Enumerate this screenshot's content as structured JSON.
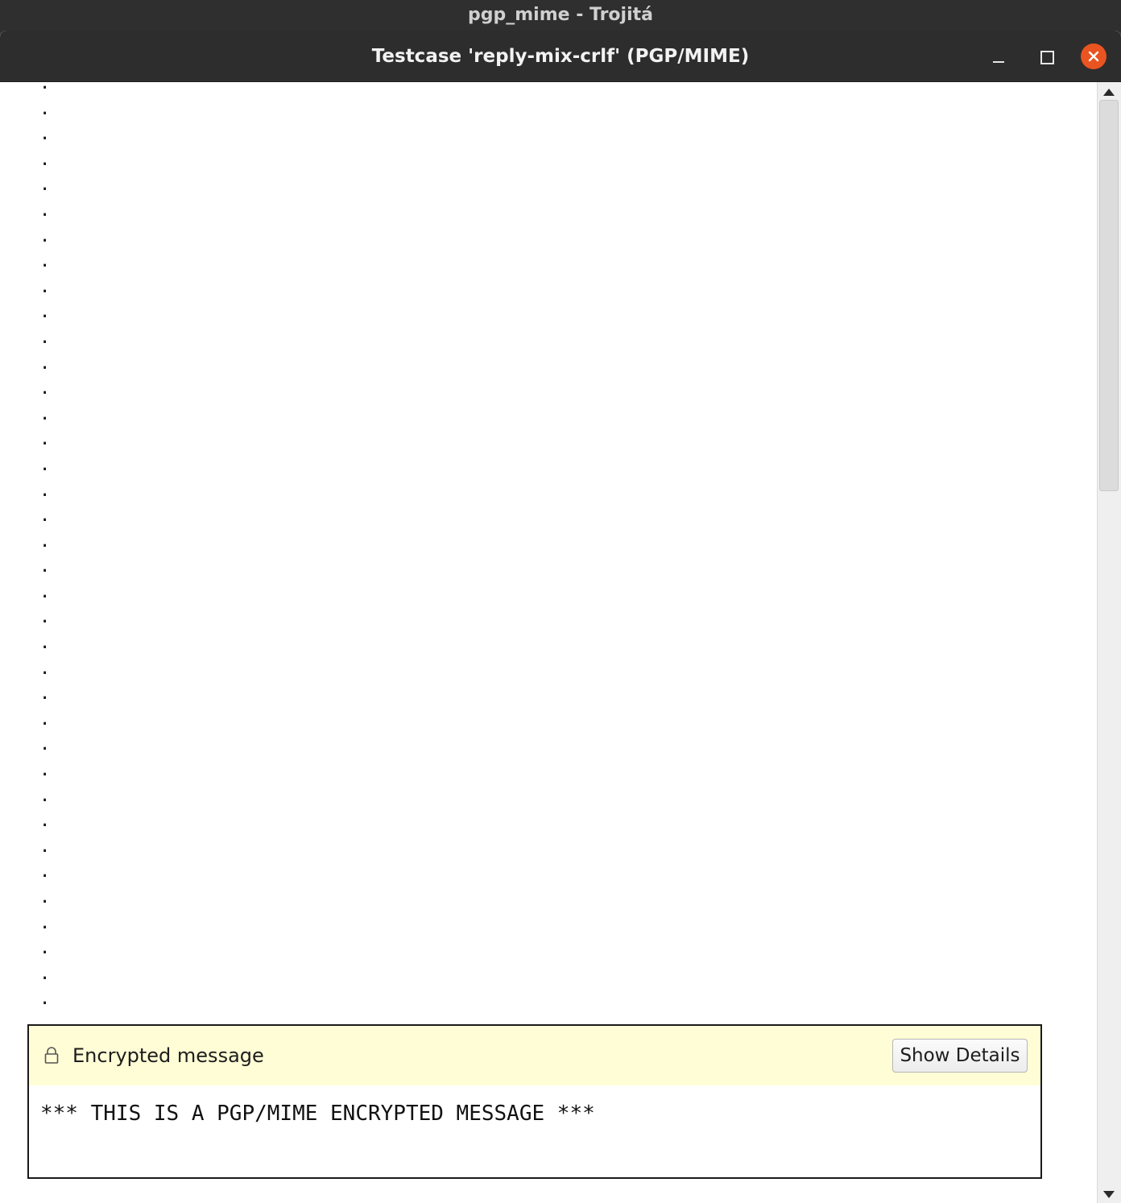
{
  "parent_window": {
    "title": "pgp_mime - Trojitá"
  },
  "window": {
    "title": "Testcase 'reply-mix-crlf' (PGP/MIME)",
    "controls": [
      "minimize-icon",
      "maximize-icon",
      "close-icon"
    ],
    "close_color": "#e95420"
  },
  "message": {
    "dot_lines": ".\n.\n.\n.\n.\n.\n.\n.\n.\n.\n.\n.\n.\n.\n.\n.\n.\n.\n.\n.\n.\n.\n.\n.\n.\n.\n.\n.\n.\n.\n.\n.\n.\n.\n.\n.\n.\n."
  },
  "encryption": {
    "icon": "lock-icon",
    "label": "Encrypted message",
    "button_label": "Show Details",
    "banner_color": "#fffdd6",
    "body_text": "*** THIS IS A PGP/MIME ENCRYPTED MESSAGE ***"
  }
}
